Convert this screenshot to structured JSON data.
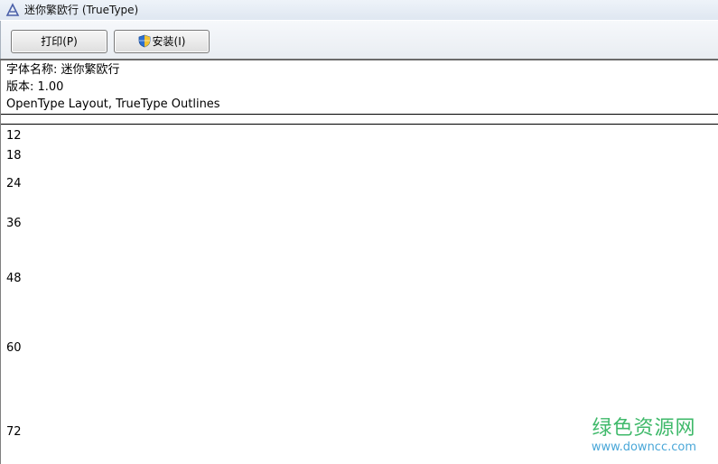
{
  "window": {
    "title": "迷你繁欧行 (TrueType)"
  },
  "toolbar": {
    "print_label": "打印(P)",
    "install_label": "安装(I)"
  },
  "font_info": {
    "name_line": "字体名称: 迷你繁欧行",
    "version_line": "版本: 1.00",
    "type_line": "OpenType Layout, TrueType Outlines"
  },
  "samples": {
    "sizes": [
      "12",
      "18",
      "24",
      "36",
      "48",
      "60",
      "72"
    ]
  },
  "watermark": {
    "name": "绿色资源网",
    "url": "www.downcc.com"
  }
}
